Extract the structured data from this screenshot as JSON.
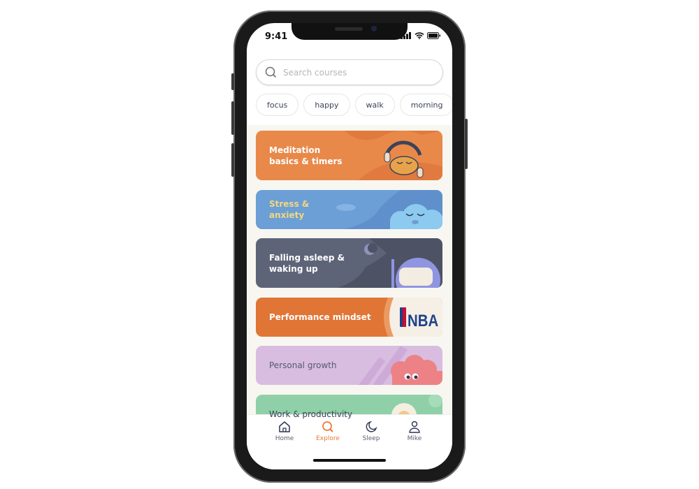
{
  "status_bar": {
    "time": "9:41"
  },
  "search": {
    "placeholder": "Search courses"
  },
  "chips": [
    "focus",
    "happy",
    "walk",
    "morning"
  ],
  "cards": [
    {
      "title": "Meditation basics & timers",
      "color": "#e8894a"
    },
    {
      "title": "Stress & anxiety",
      "color": "#6b9fd6"
    },
    {
      "title": "Falling asleep & waking up",
      "color": "#5e6478"
    },
    {
      "title": "Performance mindset",
      "color": "#e07535",
      "logo": "NBA"
    },
    {
      "title": "Personal growth",
      "color": "#d8bde0"
    },
    {
      "title": "Work & productivity",
      "color": "#8fd0a8"
    }
  ],
  "tabs": [
    {
      "label": "Home",
      "icon": "home-icon"
    },
    {
      "label": "Explore",
      "icon": "search-icon",
      "active": true
    },
    {
      "label": "Sleep",
      "icon": "moon-icon"
    },
    {
      "label": "Mike",
      "icon": "person-icon"
    }
  ],
  "colors": {
    "accent": "#e8793a",
    "text_dark": "#3d4258"
  }
}
